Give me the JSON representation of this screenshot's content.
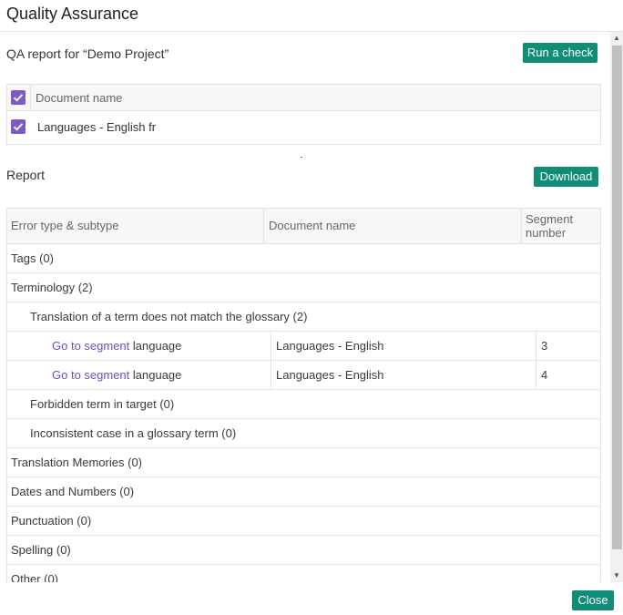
{
  "dialog": {
    "title": "Quality Assurance"
  },
  "qa": {
    "title": "QA report for “Demo Project”",
    "run_label": "Run a check",
    "doc_header": "Document name",
    "doc_name": "Languages - English fr"
  },
  "report": {
    "title": "Report",
    "download_label": "Download",
    "headers": {
      "error": "Error type & subtype",
      "document": "Document name",
      "segment_line1": "Segment",
      "segment_line2": "number"
    },
    "rows": [
      {
        "label": "Tags (0)"
      },
      {
        "label": "Terminology (2)"
      },
      {
        "label": "Translation of a term does not match the glossary (2)"
      },
      {
        "link": "Go to segment",
        "after": " language",
        "document": "Languages - English",
        "segment": "3"
      },
      {
        "link": "Go to segment",
        "after": " language",
        "document": "Languages - English",
        "segment": "4"
      },
      {
        "label": "Forbidden term in target (0)"
      },
      {
        "label": "Inconsistent case in a glossary term (0)"
      },
      {
        "label": "Translation Memories (0)"
      },
      {
        "label": "Dates and Numbers (0)"
      },
      {
        "label": "Punctuation (0)"
      },
      {
        "label": "Spelling (0)"
      },
      {
        "label": "Other (0)"
      }
    ]
  },
  "footer": {
    "close_label": "Close"
  },
  "icons": {
    "checkbox": "checkmark-icon",
    "scroll_up": "arrow-up-icon",
    "scroll_down": "arrow-down-icon"
  },
  "colors": {
    "accent": "#0f8d77",
    "checkbox": "#7c5cc4",
    "link": "#6a4fc0"
  }
}
